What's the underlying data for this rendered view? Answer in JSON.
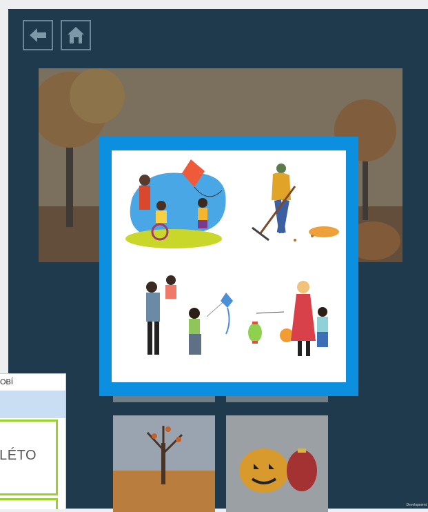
{
  "nav": {
    "back_icon": "back-arrow-icon",
    "home_icon": "home-icon"
  },
  "side_panel": {
    "title_fragment": "OBÍ",
    "card_label_fragment": "LÉTO"
  },
  "footer": {
    "text": "Development"
  },
  "colors": {
    "app_bg": "#1f3a4c",
    "modal_border": "#0d8fe0",
    "card_border": "#97d12a",
    "panel_band": "#c9ddf3"
  }
}
